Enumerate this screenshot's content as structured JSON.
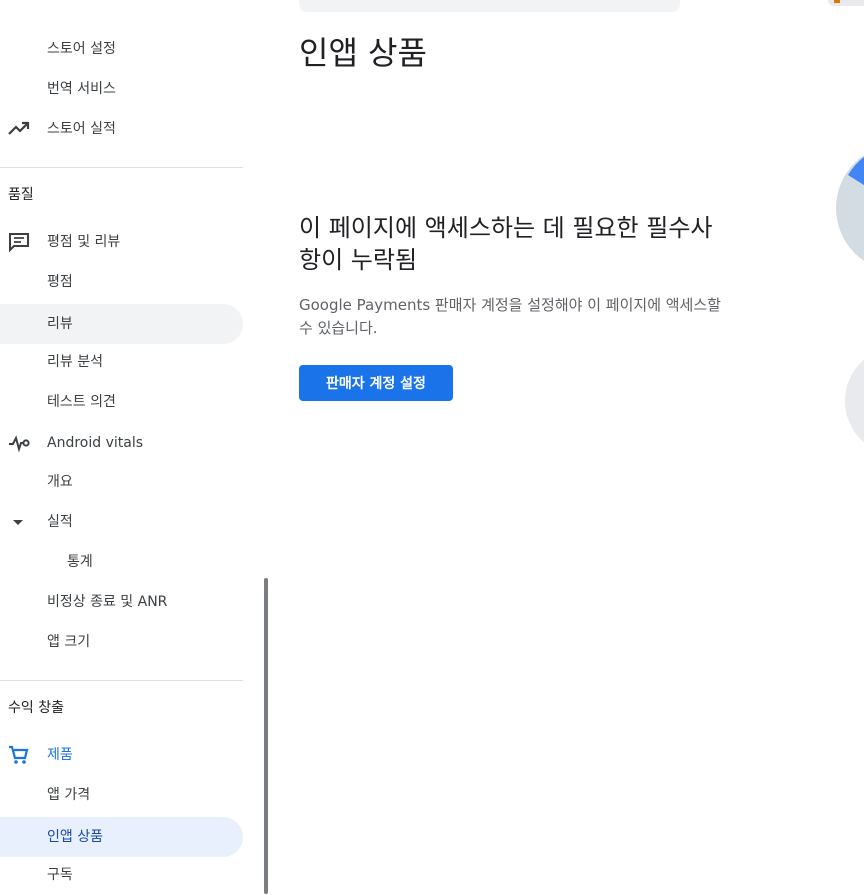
{
  "sidebar": {
    "items_top": [
      {
        "label": "스토어 설정"
      },
      {
        "label": "번역 서비스"
      },
      {
        "label": "스토어 실적",
        "icon": "trending-up-icon"
      }
    ],
    "section_quality": "품질",
    "items_quality": [
      {
        "label": "평점 및 리뷰",
        "icon": "reviews-icon"
      },
      {
        "label": "평점"
      },
      {
        "label": "리뷰"
      },
      {
        "label": "리뷰 분석"
      },
      {
        "label": "테스트 의견"
      },
      {
        "label": "Android vitals",
        "icon": "vitals-icon"
      },
      {
        "label": "개요"
      },
      {
        "label": "실적",
        "icon": "caret-down-icon"
      },
      {
        "label": "통계"
      },
      {
        "label": "비정상 종료 및 ANR"
      },
      {
        "label": "앱 크기"
      }
    ],
    "section_monetize": "수익 창출",
    "items_monetize": [
      {
        "label": "제품",
        "icon": "cart-icon"
      },
      {
        "label": "앱 가격"
      },
      {
        "label": "인앱 상품"
      },
      {
        "label": "구독"
      }
    ]
  },
  "main": {
    "title": "인앱 상품",
    "message_title": "이 페이지에 액세스하는 데 필요한 필수사항이 누락됨",
    "message_title_line1": "이 페이지에 액세스하는 데 필요한 필수사",
    "message_title_line2": "항이 누락됨",
    "message_body": "Google Payments 판매자 계정을 설정해야 이 페이지에 액세스할 수 있습니다.",
    "message_body_line1": "Google Payments 판매자 계정을 설정해야 이 페이지에 액세스할",
    "message_body_line2": "수 있습니다.",
    "button_label": "판매자 계정 설정"
  },
  "colors": {
    "accent": "#1a73e8",
    "selected_bg": "#e8f0fe",
    "hover_bg": "#f1f3f4"
  }
}
